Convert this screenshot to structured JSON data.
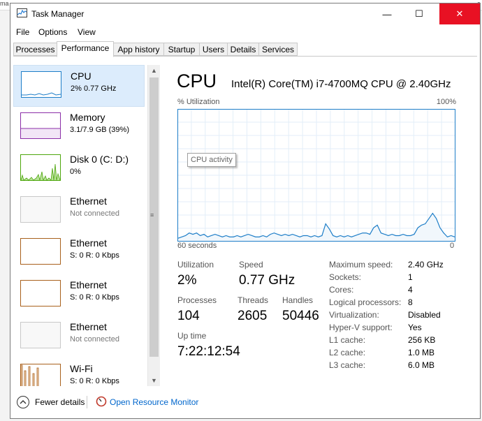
{
  "window": {
    "title": "Task Manager",
    "minimize": "—",
    "maximize": "☐",
    "close": "✕"
  },
  "menu": [
    "File",
    "Options",
    "View"
  ],
  "tabs": [
    "Processes",
    "Performance",
    "App history",
    "Startup",
    "Users",
    "Details",
    "Services"
  ],
  "active_tab": "Performance",
  "sidebar": {
    "items": [
      {
        "name": "CPU",
        "sub": "2% 0.77 GHz",
        "color": "#1e7ec8",
        "selected": true
      },
      {
        "name": "Memory",
        "sub": "3.1/7.9 GB (39%)",
        "color": "#8b2fa8"
      },
      {
        "name": "Disk 0 (C: D:)",
        "sub": "0%",
        "color": "#4da60c"
      },
      {
        "name": "Ethernet",
        "sub": "Not connected",
        "color": "#c8c8c8"
      },
      {
        "name": "Ethernet",
        "sub": "S: 0 R: 0 Kbps",
        "color": "#a8601c"
      },
      {
        "name": "Ethernet",
        "sub": "S: 0 R: 0 Kbps",
        "color": "#a8601c"
      },
      {
        "name": "Ethernet",
        "sub": "Not connected",
        "color": "#c8c8c8"
      },
      {
        "name": "Wi-Fi",
        "sub": "S: 0 R: 0 Kbps",
        "color": "#a8601c"
      }
    ]
  },
  "cpu": {
    "title": "CPU",
    "model": "Intel(R) Core(TM) i7-4700MQ CPU @ 2.40GHz",
    "util_label": "% Utilization",
    "util_max": "100%",
    "axis_left": "60 seconds",
    "axis_right": "0",
    "tooltip": "CPU activity",
    "graph_color": "#1e7ec8",
    "stats": {
      "utilization_label": "Utilization",
      "utilization": "2%",
      "speed_label": "Speed",
      "speed": "0.77 GHz",
      "processes_label": "Processes",
      "processes": "104",
      "threads_label": "Threads",
      "threads": "2605",
      "handles_label": "Handles",
      "handles": "50446",
      "uptime_label": "Up time",
      "uptime": "7:22:12:54"
    },
    "specs": [
      {
        "label": "Maximum speed:",
        "value": "2.40 GHz"
      },
      {
        "label": "Sockets:",
        "value": "1"
      },
      {
        "label": "Cores:",
        "value": "4"
      },
      {
        "label": "Logical processors:",
        "value": "8"
      },
      {
        "label": "Virtualization:",
        "value": "Disabled"
      },
      {
        "label": "Hyper-V support:",
        "value": "Yes"
      },
      {
        "label": "L1 cache:",
        "value": "256 KB"
      },
      {
        "label": "L2 cache:",
        "value": "1.0 MB"
      },
      {
        "label": "L3 cache:",
        "value": "6.0 MB"
      }
    ]
  },
  "chart_data": {
    "type": "area",
    "title": "",
    "ylim": [
      0,
      100
    ],
    "x_range_seconds": [
      60,
      0
    ],
    "values": [
      2,
      3,
      4,
      6,
      5,
      6,
      4,
      5,
      3,
      4,
      5,
      4,
      3,
      4,
      3,
      3,
      4,
      3,
      4,
      5,
      4,
      3,
      3,
      4,
      3,
      5,
      6,
      5,
      4,
      5,
      4,
      5,
      4,
      3,
      4,
      4,
      3,
      4,
      3,
      4,
      13,
      9,
      4,
      3,
      4,
      3,
      4,
      3,
      4,
      5,
      6,
      6,
      5,
      10,
      12,
      6,
      5,
      4,
      5,
      4,
      4,
      5,
      4,
      4,
      5,
      10,
      12,
      13,
      17,
      21,
      17,
      10,
      6,
      3,
      4,
      3
    ]
  },
  "footer": {
    "fewer": "Fewer details",
    "resmon": "Open Resource Monitor"
  }
}
